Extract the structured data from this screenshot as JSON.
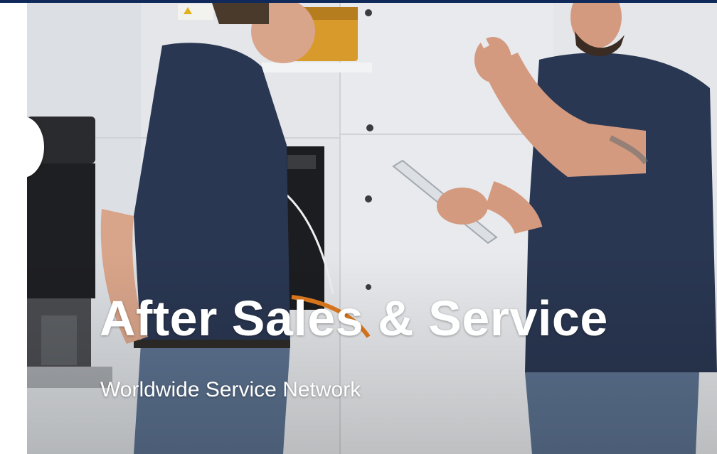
{
  "hero": {
    "title": "After Sales & Service",
    "subtitle": "Worldwide Service Network",
    "image": "two-technicians-with-tablet-at-industrial-pump"
  },
  "icons": {
    "carousel_prev": "carousel-prev-button"
  },
  "colors": {
    "top_bar": "#0f2a5a",
    "shirt": "#2a3752",
    "jeans": "#5c7290",
    "pump": "#1e1f22",
    "text": "#ffffff"
  }
}
